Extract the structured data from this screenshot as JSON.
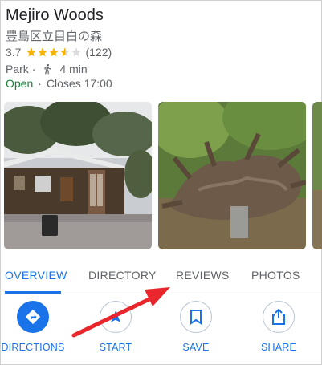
{
  "place": {
    "name": "Mejiro Woods",
    "local_name": "豊島区立目白の森",
    "rating": "3.7",
    "rating_stars": 3.7,
    "review_count": "(122)",
    "category": "Park",
    "walk_time": "4 min",
    "open_status": "Open",
    "closes": "Closes 17:00"
  },
  "tabs": [
    {
      "label": "OVERVIEW",
      "active": true
    },
    {
      "label": "DIRECTORY",
      "active": false
    },
    {
      "label": "REVIEWS",
      "active": false
    },
    {
      "label": "PHOTOS",
      "active": false
    }
  ],
  "actions": [
    {
      "label": "DIRECTIONS",
      "icon": "directions-icon"
    },
    {
      "label": "START",
      "icon": "navigation-arrow-icon"
    },
    {
      "label": "SAVE",
      "icon": "bookmark-icon"
    },
    {
      "label": "SHARE",
      "icon": "share-icon"
    }
  ],
  "colors": {
    "accent": "#1a73e8",
    "open_green": "#188038",
    "star": "#f4b400",
    "annotation_arrow": "#e8262b"
  }
}
